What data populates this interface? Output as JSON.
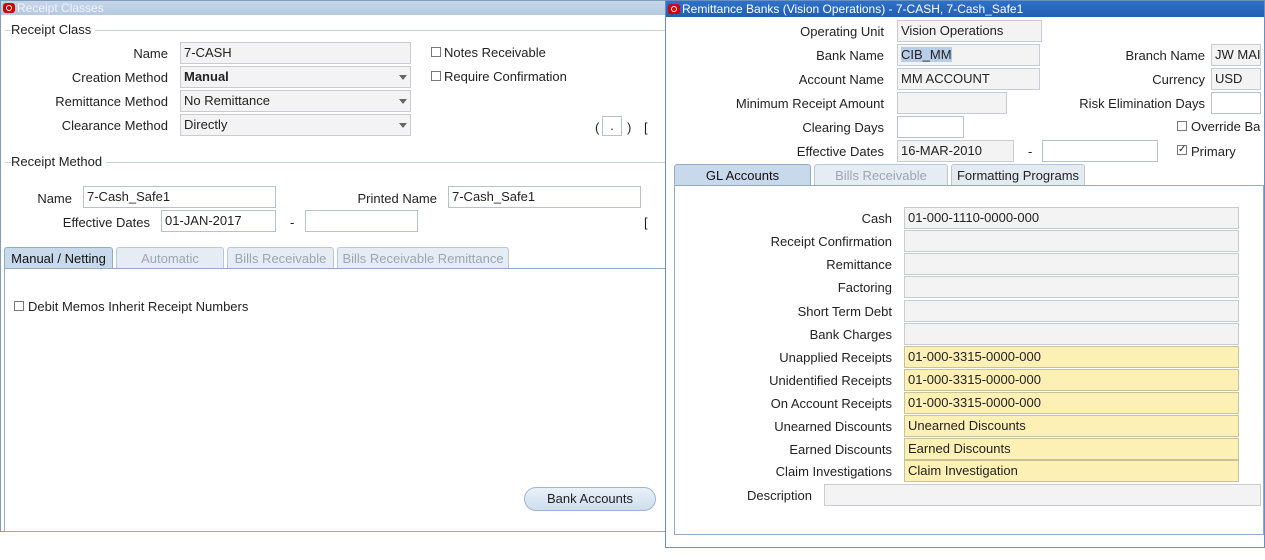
{
  "receipt_classes": {
    "window_title": "Receipt Classes",
    "section_receipt_class": "Receipt Class",
    "name_label": "Name",
    "name_value": "7-CASH",
    "creation_method_label": "Creation Method",
    "creation_method_value": "Manual",
    "remittance_method_label": "Remittance Method",
    "remittance_method_value": "No Remittance",
    "clearance_method_label": "Clearance Method",
    "clearance_method_value": "Directly",
    "notes_receivable_label": "Notes Receivable",
    "require_confirmation_label": "Require Confirmation",
    "paren_open": "(",
    "paren_close": ")",
    "dot": ".",
    "bracket": "[",
    "section_receipt_method": "Receipt Method",
    "rm_name_label": "Name",
    "rm_name_value": "7-Cash_Safe1",
    "printed_name_label": "Printed Name",
    "printed_name_value": "7-Cash_Safe1",
    "effective_dates_label": "Effective Dates",
    "effective_from": "01-JAN-2017",
    "effective_to": "",
    "dash": "-",
    "tabs": [
      "Manual / Netting",
      "Automatic",
      "Bills Receivable",
      "Bills Receivable Remittance"
    ],
    "debit_memos_label": "Debit Memos Inherit Receipt Numbers",
    "bank_accounts_button": "Bank Accounts"
  },
  "remittance_banks": {
    "window_title": "Remittance Banks (Vision Operations) - 7-CASH, 7-Cash_Safe1",
    "operating_unit_label": "Operating Unit",
    "operating_unit_value": "Vision Operations",
    "bank_name_label": "Bank Name",
    "bank_name_value": "CIB_MM",
    "branch_name_label": "Branch Name",
    "branch_name_value": "JW MAI",
    "account_name_label": "Account Name",
    "account_name_value": "MM ACCOUNT",
    "currency_label": "Currency",
    "currency_value": "USD",
    "min_receipt_label": "Minimum Receipt Amount",
    "min_receipt_value": "",
    "risk_elim_label": "Risk Elimination Days",
    "risk_elim_value": "",
    "clearing_days_label": "Clearing Days",
    "clearing_days_value": "",
    "override_label": "Override Ba",
    "effective_dates_label": "Effective Dates",
    "effective_from": "16-MAR-2010",
    "effective_to": "",
    "dash": "-",
    "primary_label": "Primary",
    "primary_checked": "✓",
    "tabs": [
      "GL Accounts",
      "Bills Receivable",
      "Formatting Programs"
    ],
    "gl": {
      "cash_label": "Cash",
      "cash_value": "01-000-1110-0000-000",
      "receipt_confirmation_label": "Receipt Confirmation",
      "receipt_confirmation_value": "",
      "remittance_label": "Remittance",
      "remittance_value": "",
      "factoring_label": "Factoring",
      "factoring_value": "",
      "short_term_debt_label": "Short Term Debt",
      "short_term_debt_value": "",
      "bank_charges_label": "Bank Charges",
      "bank_charges_value": "",
      "unapplied_label": "Unapplied Receipts",
      "unapplied_value": "01-000-3315-0000-000",
      "unidentified_label": "Unidentified Receipts",
      "unidentified_value": "01-000-3315-0000-000",
      "on_account_label": "On Account Receipts",
      "on_account_value": "01-000-3315-0000-000",
      "unearned_label": "Unearned Discounts",
      "unearned_value": "Unearned Discounts",
      "earned_label": "Earned Discounts",
      "earned_value": "Earned Discounts",
      "claim_label": "Claim Investigations",
      "claim_value": "Claim Investigation",
      "description_label": "Description",
      "description_value": ""
    }
  }
}
